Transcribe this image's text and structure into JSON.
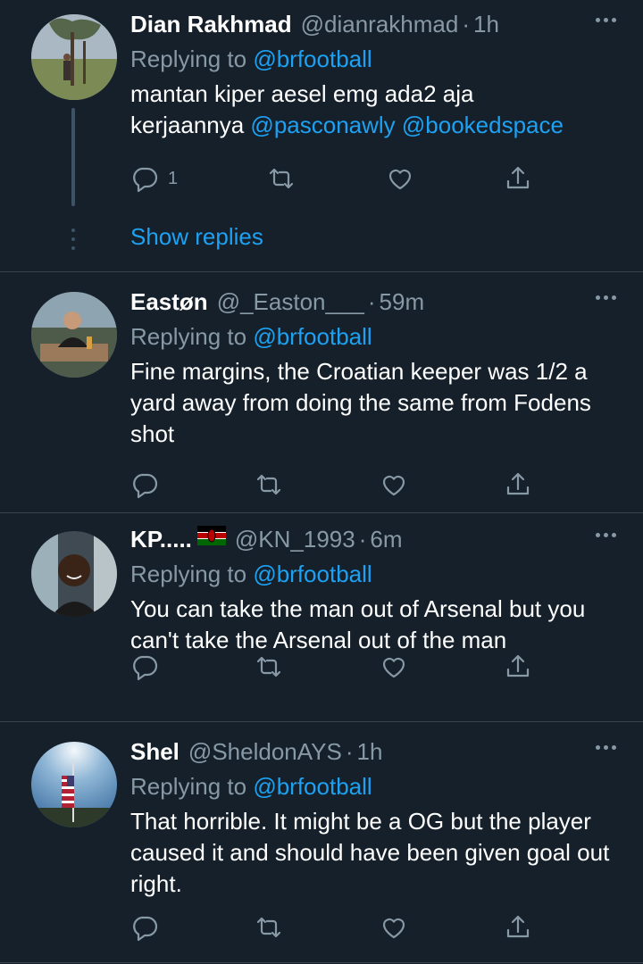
{
  "tweets": [
    {
      "name": "Dian Rakhmad",
      "handle": "@dianrakhmad",
      "time": "1h",
      "reply_prefix": "Replying to ",
      "reply_to": "@brfootball",
      "text_line1": "mantan kiper aesel emg ada2 aja",
      "text_line2_prefix": "kerjaannya ",
      "text_mention1": "@pasconawly",
      "text_mention2": "@bookedspace",
      "reply_count": "1",
      "show_replies": "Show replies"
    },
    {
      "name": "Eastøn",
      "handle": "@_Easton___",
      "time": "59m",
      "reply_prefix": "Replying to ",
      "reply_to": "@brfootball",
      "text": "Fine margins, the Croatian keeper was 1/2 a yard away from doing the same from Fodens shot"
    },
    {
      "name": "KP.....",
      "handle": "@KN_1993",
      "time": "6m",
      "reply_prefix": "Replying to ",
      "reply_to": "@brfootball",
      "text": "You can take the man out of Arsenal but you can't take the Arsenal out of the man"
    },
    {
      "name": "Shel",
      "handle": "@SheldonAYS",
      "time": "1h",
      "reply_prefix": "Replying to ",
      "reply_to": "@brfootball",
      "text": "That horrible. It might be a OG but the player caused it and should have been given goal out right."
    }
  ],
  "separator": "·",
  "colors": {
    "background": "#15202b",
    "text": "#ffffff",
    "secondary": "#8899a6",
    "accent": "#1da1f2",
    "divider": "#38444d"
  },
  "icons": [
    "reply-icon",
    "retweet-icon",
    "like-icon",
    "share-icon",
    "more-icon",
    "kenya-flag-icon"
  ]
}
